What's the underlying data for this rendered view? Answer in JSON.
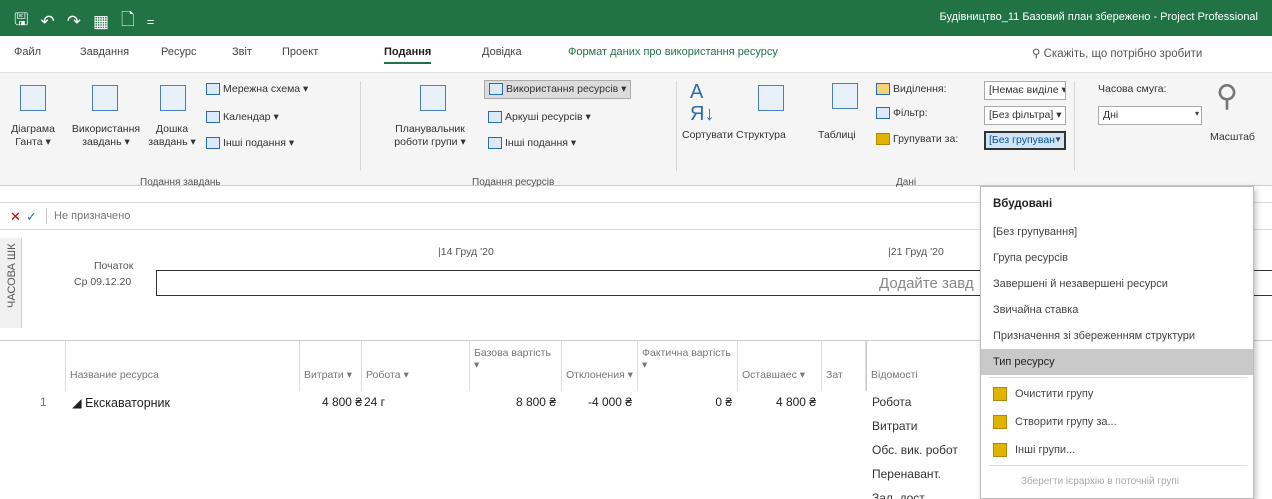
{
  "window": {
    "title": "Будівництво_11 Базовий план збережено - Project Professional",
    "accent": "#217346"
  },
  "qat": {
    "save": "🖫",
    "undo": "↶",
    "redo": "↷",
    "table": "▦",
    "new": "🗋",
    "more": "="
  },
  "tabs": [
    "Файл",
    "Завдання",
    "Ресурс",
    "Звіт",
    "Проект",
    "Подання",
    "Довідка",
    "Формат даних про використання ресурсу"
  ],
  "tellme": "Скажіть, що потрібно зробити",
  "ribbon": {
    "gantt": [
      "Діаграма",
      "Ганта ▾"
    ],
    "usage": [
      "Використання",
      "завдань ▾"
    ],
    "board": [
      "Дошка",
      "завдань ▾"
    ],
    "network": "Мережна схема ▾",
    "calendar": "Календар ▾",
    "other_task": "Інші подання ▾",
    "group_task": "Подання завдань",
    "planner": [
      "Планувальник",
      "роботи групи ▾"
    ],
    "res_usage": "Використання ресурсів ▾",
    "res_sheet": "Аркуші ресурсів ▾",
    "other_res": "Інші подання ▾",
    "group_res": "Подання ресурсів",
    "sort": "Сортувати",
    "outline": "Структура",
    "tables": "Таблиці",
    "highlight": "Виділення:",
    "filter": "Фільтр:",
    "groupby": "Групувати за:",
    "highlight_val": "[Немає виділе ▾",
    "filter_val": "[Без фільтра] ▾",
    "groupby_val": "[Без групуван",
    "group_data": "Дані",
    "timescale": "Часова смуга:",
    "timescale_val": "Дні",
    "zoom": "Масштаб"
  },
  "formula": {
    "cancel": "✕",
    "ok": "✓",
    "value": "Не призначено"
  },
  "timeline": {
    "side": "ЧАСОВА ШК",
    "start_label": "Початок",
    "start_date": "Ср 09.12.20",
    "d1": "14 Груд '20",
    "d2": "21 Груд '20",
    "add": "Додайте завд"
  },
  "grid": {
    "headers": [
      "Название ресурса",
      "Витрати ▾",
      "Робота ▾",
      "Базова вартість ▾",
      "Отклонения ▾",
      "Фактична вартість ▾",
      "Оставшаес ▾",
      "Зат"
    ],
    "row": {
      "num": "1",
      "name": "◢ Екскаваторник",
      "cost": "4 800 ₴",
      "work": "24 г",
      "base": "8 800 ₴",
      "dev": "-4 000 ₴",
      "actual": "0 ₴",
      "remain": "4 800 ₴"
    },
    "detail_header": "Відомості",
    "details": [
      "Робота",
      "Витрати",
      "Обс. вик. робот",
      "Перенавант.",
      "Зал. дост."
    ]
  },
  "menu": {
    "builtin": "Вбудовані",
    "items": [
      "[Без групування]",
      "Група ресурсів",
      "Завершені й незавершені ресурси",
      "Звичайна ставка",
      "Призначення зі збереженням структури",
      "Тип ресурсу"
    ],
    "clear": "Очистити групу",
    "create": "Створити групу за...",
    "more": "Інші групи...",
    "keep": "Зберегти ієрархію в поточній групі"
  }
}
